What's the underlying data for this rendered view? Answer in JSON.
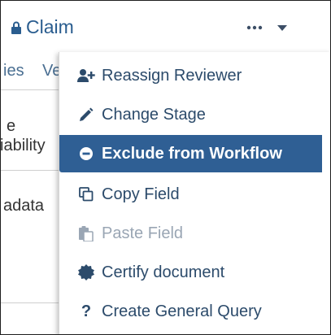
{
  "header": {
    "title": "Claim",
    "lock_icon": "lock-icon",
    "more_icon": "ellipsis-icon",
    "caret_icon": "caret-down-icon"
  },
  "background_panel": {
    "tab_fragment_1": "ies",
    "tab_fragment_2": "Ve",
    "line1": "e",
    "line2": "iability",
    "line3": "adata"
  },
  "menu": {
    "items": [
      {
        "label": "Reassign Reviewer",
        "icon": "user-plus-icon",
        "state": "normal"
      },
      {
        "label": "Change Stage",
        "icon": "pencil-icon",
        "state": "normal"
      },
      {
        "label": "Exclude from Workflow",
        "icon": "minus-circle-icon",
        "state": "highlighted"
      },
      {
        "label": "Copy Field",
        "icon": "copy-icon",
        "state": "normal"
      },
      {
        "label": "Paste Field",
        "icon": "paste-icon",
        "state": "disabled"
      },
      {
        "label": "Certify document",
        "icon": "certificate-icon",
        "state": "normal"
      },
      {
        "label": "Create General Query",
        "icon": "question-icon",
        "state": "normal"
      }
    ]
  },
  "colors": {
    "accent": "#2f5f94",
    "link": "#2a5d8f",
    "menu_text": "#2c4b6b",
    "disabled_text": "#9aa6b4"
  }
}
